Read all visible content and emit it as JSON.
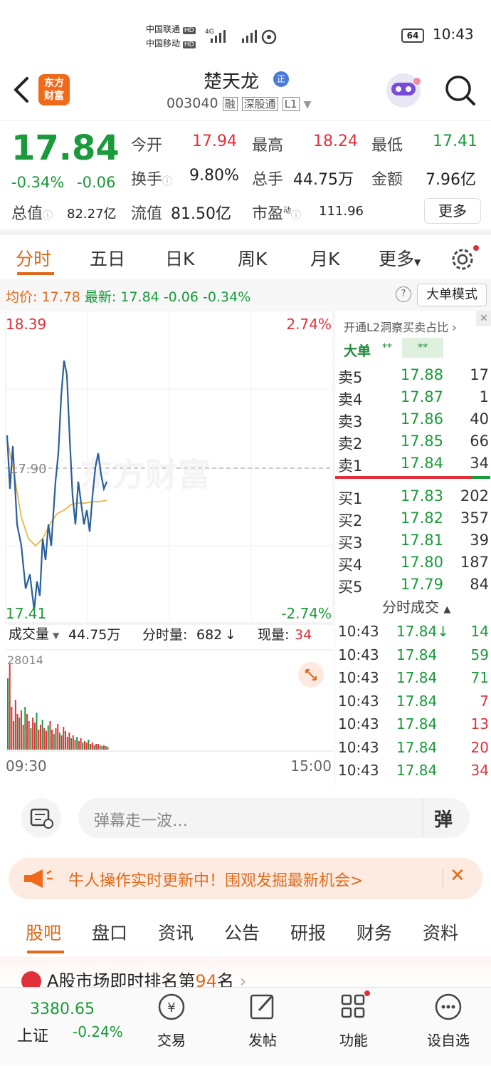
{
  "status": {
    "carrier1": "中国联通",
    "carrier2": "中国移动",
    "hd": "HD",
    "net": "4G",
    "battery": "64",
    "time": "10:43"
  },
  "header": {
    "logo": "东方\n财富",
    "logo_l1": "东方",
    "logo_l2": "财富",
    "stock_name": "楚天龙",
    "name_badge": "正",
    "code": "003040",
    "tags": [
      "融",
      "深股通",
      "L1"
    ]
  },
  "quote": {
    "price": "17.84",
    "pct": "-0.34%",
    "chg": "-0.06",
    "open_label": "今开",
    "open": "17.94",
    "high_label": "最高",
    "high": "18.24",
    "low_label": "最低",
    "low": "17.41",
    "turnover_label": "换手",
    "turnover": "9.80%",
    "volume_label": "总手",
    "volume": "44.75万",
    "amount_label": "金额",
    "amount": "7.96亿",
    "mcap_label": "总值",
    "mcap": "82.27亿",
    "float_label": "流值",
    "float": "81.50亿",
    "pe_label": "市盈",
    "pe_sup": "动",
    "pe": "111.96",
    "more": "更多"
  },
  "tabs": [
    "分时",
    "五日",
    "日K",
    "周K",
    "月K",
    "更多"
  ],
  "chart_info": {
    "avg_label": "均价:",
    "avg": "17.78",
    "latest_label": "最新:",
    "latest": "17.84",
    "chg": "-0.06",
    "pct": "-0.34%",
    "big_mode": "大单模式"
  },
  "chart_data": {
    "type": "line",
    "y_top": "18.39",
    "y_bottom": "17.41",
    "pct_top": "2.74%",
    "pct_bottom": "-2.74%",
    "ref_price": "17.90",
    "watermark": "东方财富",
    "x_start": "09:30",
    "x_end": "15:00",
    "volume_label": "成交量",
    "volume_total": "44.75万",
    "minute_vol_label": "分时量:",
    "minute_vol": "682",
    "now_vol_label": "现量:",
    "now_vol": "34",
    "vol_max": "28014"
  },
  "orderbook": {
    "l2_title": "开通L2洞察买卖占比",
    "big_label": "大单",
    "big_v1": "**",
    "big_v2": "**",
    "sells": [
      {
        "l": "卖5",
        "p": "17.88",
        "v": "17"
      },
      {
        "l": "卖4",
        "p": "17.87",
        "v": "1"
      },
      {
        "l": "卖3",
        "p": "17.86",
        "v": "40"
      },
      {
        "l": "卖2",
        "p": "17.85",
        "v": "66"
      },
      {
        "l": "卖1",
        "p": "17.84",
        "v": "34"
      }
    ],
    "buys": [
      {
        "l": "买1",
        "p": "17.83",
        "v": "202"
      },
      {
        "l": "买2",
        "p": "17.82",
        "v": "357"
      },
      {
        "l": "买3",
        "p": "17.81",
        "v": "39"
      },
      {
        "l": "买4",
        "p": "17.80",
        "v": "187"
      },
      {
        "l": "买5",
        "p": "17.79",
        "v": "84"
      }
    ],
    "ticks_title": "分时成交",
    "ticks": [
      {
        "t": "10:43",
        "p": "17.84↓",
        "v": "14"
      },
      {
        "t": "10:43",
        "p": "17.84",
        "v": "59"
      },
      {
        "t": "10:43",
        "p": "17.84",
        "v": "71"
      },
      {
        "t": "10:43",
        "p": "17.84",
        "v": "7"
      },
      {
        "t": "10:43",
        "p": "17.84",
        "v": "13"
      },
      {
        "t": "10:43",
        "p": "17.84",
        "v": "20"
      },
      {
        "t": "10:43",
        "p": "17.84",
        "v": "34"
      }
    ]
  },
  "danmu": {
    "placeholder": "弹幕走一波…",
    "btn": "弹"
  },
  "banner": {
    "text": "牛人操作实时更新中！围观发掘最新机会>"
  },
  "subtabs": [
    "股吧",
    "盘口",
    "资讯",
    "公告",
    "研报",
    "财务",
    "资料"
  ],
  "rank": {
    "text_pre": "A股市场即时排名第",
    "rank_num": "94",
    "text_post": "名"
  },
  "bottom": {
    "index_value": "3380.65",
    "index_name": "上证",
    "index_pct": "-0.24%",
    "trade": "交易",
    "post": "发帖",
    "func": "功能",
    "watch": "设自选"
  }
}
